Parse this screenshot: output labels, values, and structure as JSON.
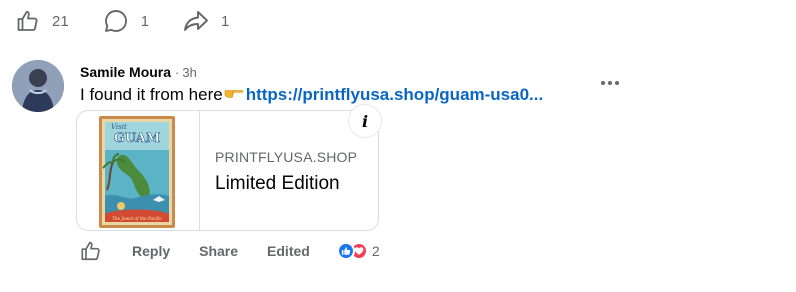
{
  "stats": {
    "likes": "21",
    "comments": "1",
    "shares": "1"
  },
  "comment": {
    "author": "Samile Moura",
    "separator": "·",
    "time": "3h",
    "text_before": "I found it from here",
    "link_text": "https://printflyusa.shop/guam-usa0..."
  },
  "preview": {
    "domain": "PRINTFLYUSA.SHOP",
    "title": "Limited Edition",
    "info_label": "i",
    "thumbnail_text": {
      "top": "Visit",
      "name": "GUAM",
      "bottom": "The Jewel of the Pacific"
    }
  },
  "actions": {
    "reply": "Reply",
    "share": "Share",
    "edited": "Edited",
    "reaction_count": "2"
  },
  "colors": {
    "link": "#0a66c2",
    "muted": "#65676b",
    "like_blue": "#1877f2",
    "love_red": "#f33e58"
  }
}
